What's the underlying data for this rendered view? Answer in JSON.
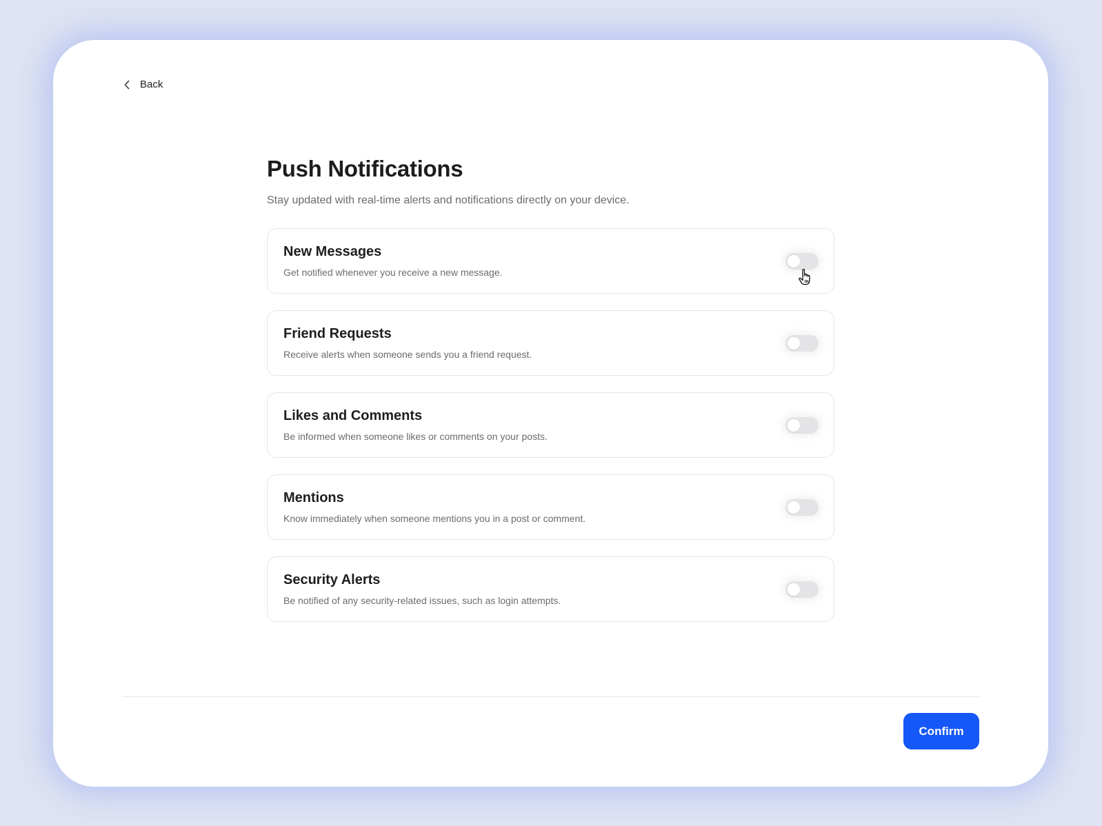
{
  "nav": {
    "back_label": "Back",
    "back_icon": "chevron-left-icon"
  },
  "header": {
    "title": "Push Notifications",
    "subtitle": "Stay updated with real-time alerts and notifications directly on your device."
  },
  "settings": [
    {
      "title": "New Messages",
      "description": "Get notified whenever you receive a new message.",
      "enabled": false
    },
    {
      "title": "Friend Requests",
      "description": "Receive alerts when someone sends you a friend request.",
      "enabled": false
    },
    {
      "title": "Likes and Comments",
      "description": "Be informed when someone likes or comments on your posts.",
      "enabled": false
    },
    {
      "title": "Mentions",
      "description": "Know immediately when someone mentions you in a post or comment.",
      "enabled": false
    },
    {
      "title": "Security Alerts",
      "description": "Be notified of any security-related issues, such as login attempts.",
      "enabled": false
    }
  ],
  "footer": {
    "confirm_label": "Confirm"
  },
  "colors": {
    "accent": "#1557f7",
    "background": "#dfe3f3",
    "toggle_off": "#e4e4e6"
  }
}
